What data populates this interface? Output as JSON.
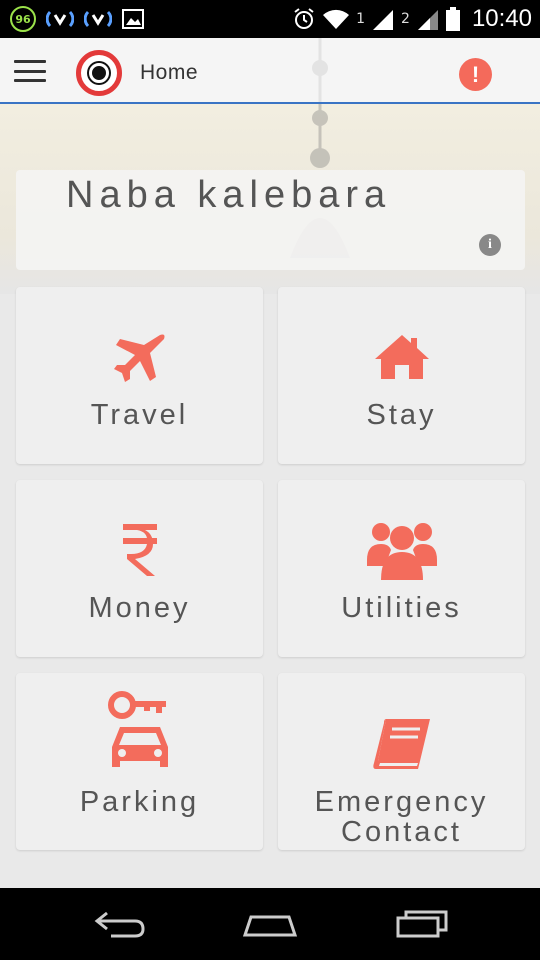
{
  "status_bar": {
    "battery_badge": "96",
    "sim1": "1",
    "sim2": "2",
    "time": "10:40"
  },
  "app_bar": {
    "title": "Home"
  },
  "banner": {
    "title": "Naba kalebara"
  },
  "tiles": [
    {
      "label": "Travel",
      "icon": "airplane-icon"
    },
    {
      "label": "Stay",
      "icon": "home-icon"
    },
    {
      "label": "Money",
      "icon": "rupee-icon"
    },
    {
      "label": "Utilities",
      "icon": "group-icon"
    },
    {
      "label": "Parking",
      "icon": "car-key-icon"
    },
    {
      "label_line1": "Emergency",
      "label_line2": "Contact",
      "icon": "book-icon"
    }
  ],
  "colors": {
    "accent": "#f36c5c",
    "logo_ring": "#e33a3a",
    "divider": "#3a74c4"
  }
}
